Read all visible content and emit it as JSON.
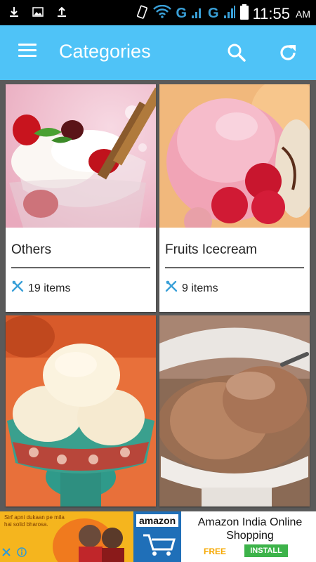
{
  "status_bar": {
    "time": "11:55",
    "ampm": "AM",
    "network_labels": [
      "G",
      "G"
    ],
    "icons": [
      "download-icon",
      "image-icon",
      "upload-icon",
      "vibrate-icon",
      "wifi-icon",
      "signal-icon",
      "battery-icon"
    ]
  },
  "app_bar": {
    "title": "Categories",
    "bg_color": "#4fc3f7",
    "icons": [
      "menu-icon",
      "search-icon",
      "refresh-icon"
    ]
  },
  "categories": [
    {
      "name": "Others",
      "count": "19 items",
      "image": "ice-cream-sundae-glass"
    },
    {
      "name": "Fruits Icecream",
      "count": "9 items",
      "image": "strawberry-ice-cream-scoops"
    },
    {
      "name": "",
      "count": "",
      "image": "vanilla-ice-cream-bowl"
    },
    {
      "name": "",
      "count": "",
      "image": "chocolate-ice-cream-bowl"
    }
  ],
  "ad": {
    "left_text": "Sirf apni dukaan pe mila hai solid bharosa.",
    "brand": "amazon",
    "title": "Amazon India Online Shopping",
    "free_label": "FREE",
    "install_label": "INSTALL"
  }
}
